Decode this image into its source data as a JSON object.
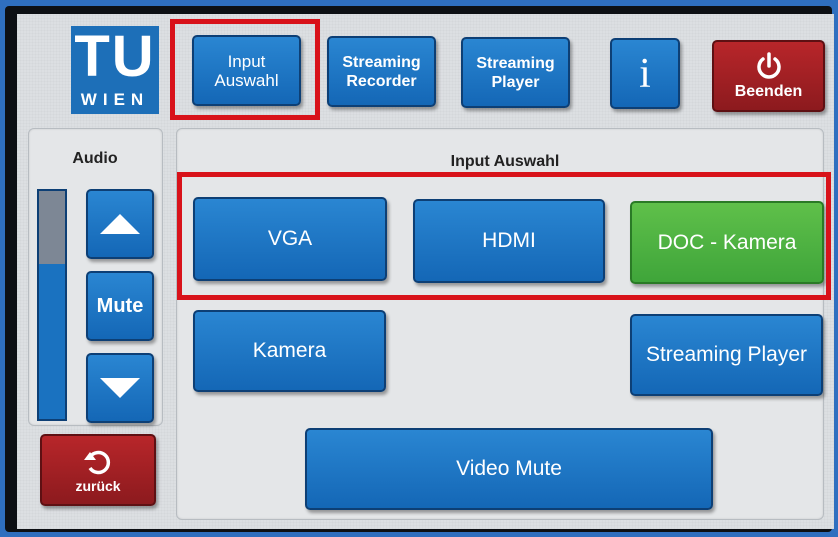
{
  "logo": {
    "line1": "TU",
    "line2": "WIEN"
  },
  "topbar": {
    "input_auswahl": "Input\nAuswahl",
    "streaming_recorder": "Streaming\nRecorder",
    "streaming_player": "Streaming\nPlayer",
    "info": "i",
    "beenden": "Beenden"
  },
  "audio": {
    "title": "Audio",
    "mute": "Mute",
    "volume_level": 0.68,
    "back_label": "zurück"
  },
  "input_panel": {
    "title": "Input Auswahl",
    "vga": "VGA",
    "hdmi": "HDMI",
    "doc_kamera": "DOC - Kamera",
    "kamera": "Kamera",
    "streaming_player": "Streaming Player",
    "video_mute": "Video Mute"
  },
  "colors": {
    "button_blue": "#1f78c7",
    "active_green": "#4fb544",
    "exit_red": "#a82024",
    "highlight_red": "#d8121a"
  }
}
